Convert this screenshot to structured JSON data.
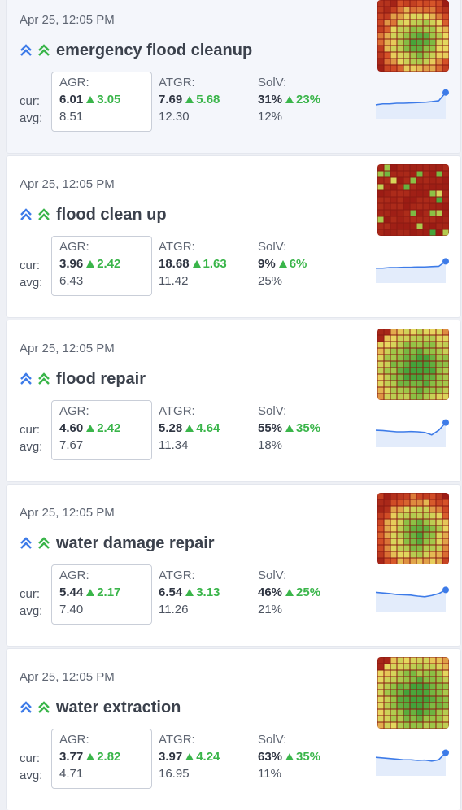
{
  "colors": {
    "accent_blue": "#3d7be8",
    "accent_green": "#3ab54a",
    "heat_red_dark": "#9b1b14",
    "heat_green": "#43a33a",
    "heat_yellow": "#e8d860"
  },
  "icons": {
    "rank_up_blue": "double-chevron-up-icon",
    "rank_up_green": "double-chevron-up-icon",
    "delta": "triangle-up-icon"
  },
  "labels": {
    "cur": "cur:",
    "avg": "avg:",
    "agr": "AGR:",
    "atgr": "ATGR:",
    "solv": "SolV:"
  },
  "cards": [
    {
      "date": "Apr 25, 12:05 PM",
      "keyword": "emergency flood cleanup",
      "agr": {
        "cur": "6.01",
        "delta": "3.05",
        "avg": "8.51"
      },
      "atgr": {
        "cur": "7.69",
        "delta": "5.68",
        "avg": "12.30"
      },
      "solv": {
        "cur": "31%",
        "delta": "23%",
        "avg": "12%"
      },
      "heatmap": "ring",
      "sparkline": [
        0.55,
        0.52,
        0.52,
        0.5,
        0.5,
        0.49,
        0.48,
        0.47,
        0.45,
        0.42,
        0.15
      ]
    },
    {
      "date": "Apr 25, 12:05 PM",
      "keyword": "flood clean up",
      "agr": {
        "cur": "3.96",
        "delta": "2.42",
        "avg": "6.43"
      },
      "atgr": {
        "cur": "18.68",
        "delta": "1.63",
        "avg": "11.42"
      },
      "solv": {
        "cur": "9%",
        "delta": "6%",
        "avg": "25%"
      },
      "heatmap": "sparse",
      "sparkline": [
        0.52,
        0.52,
        0.5,
        0.5,
        0.49,
        0.49,
        0.48,
        0.48,
        0.47,
        0.46,
        0.3
      ]
    },
    {
      "date": "Apr 25, 12:05 PM",
      "keyword": "flood repair",
      "agr": {
        "cur": "4.60",
        "delta": "2.42",
        "avg": "7.67"
      },
      "atgr": {
        "cur": "5.28",
        "delta": "4.64",
        "avg": "11.34"
      },
      "solv": {
        "cur": "55%",
        "delta": "35%",
        "avg": "18%"
      },
      "heatmap": "green",
      "sparkline": [
        0.45,
        0.46,
        0.48,
        0.5,
        0.5,
        0.49,
        0.5,
        0.52,
        0.6,
        0.45,
        0.2
      ]
    },
    {
      "date": "Apr 25, 12:05 PM",
      "keyword": "water damage repair",
      "agr": {
        "cur": "5.44",
        "delta": "2.17",
        "avg": "7.40"
      },
      "atgr": {
        "cur": "6.54",
        "delta": "3.13",
        "avg": "11.26"
      },
      "solv": {
        "cur": "46%",
        "delta": "25%",
        "avg": "21%"
      },
      "heatmap": "ring",
      "sparkline": [
        0.38,
        0.4,
        0.42,
        0.45,
        0.46,
        0.47,
        0.5,
        0.52,
        0.48,
        0.42,
        0.3
      ]
    },
    {
      "date": "Apr 25, 12:05 PM",
      "keyword": "water extraction",
      "agr": {
        "cur": "3.77",
        "delta": "2.82",
        "avg": "4.71"
      },
      "atgr": {
        "cur": "3.97",
        "delta": "4.24",
        "avg": "16.95"
      },
      "solv": {
        "cur": "63%",
        "delta": "35%",
        "avg": "11%"
      },
      "heatmap": "green",
      "sparkline": [
        0.4,
        0.42,
        0.44,
        0.46,
        0.48,
        0.48,
        0.5,
        0.49,
        0.52,
        0.48,
        0.25
      ]
    }
  ]
}
